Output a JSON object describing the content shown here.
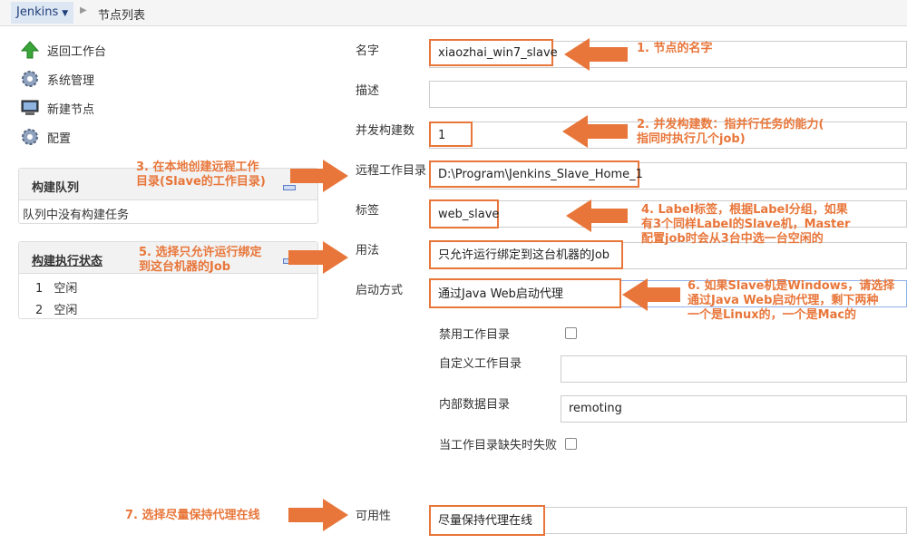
{
  "breadcrumb": {
    "root": "Jenkins",
    "current": "节点列表"
  },
  "sidebar": {
    "items": [
      {
        "label": "返回工作台",
        "icon": "up-arrow-icon"
      },
      {
        "label": "系统管理",
        "icon": "gear-icon"
      },
      {
        "label": "新建节点",
        "icon": "computer-icon"
      },
      {
        "label": "配置",
        "icon": "gear-icon"
      }
    ]
  },
  "build_queue": {
    "title": "构建队列",
    "empty_text": "队列中没有构建任务"
  },
  "executors": {
    "title": "构建执行状态",
    "rows": [
      {
        "num": "1",
        "status": "空闲"
      },
      {
        "num": "2",
        "status": "空闲"
      }
    ]
  },
  "form": {
    "name": {
      "label": "名字",
      "value": "xiaozhai_win7_slave"
    },
    "description": {
      "label": "描述",
      "value": ""
    },
    "executors": {
      "label": "并发构建数",
      "value": "1"
    },
    "remote_root": {
      "label": "远程工作目录",
      "value": "D:\\Program\\Jenkins_Slave_Home_1"
    },
    "labels": {
      "label": "标签",
      "value": "web_slave"
    },
    "usage": {
      "label": "用法",
      "value": "只允许运行绑定到这台机器的Job"
    },
    "launch": {
      "label": "启动方式",
      "value": "通过Java Web启动代理"
    },
    "disable_workdir": {
      "label": "禁用工作目录"
    },
    "custom_workdir": {
      "label": "自定义工作目录",
      "value": ""
    },
    "internal_dir": {
      "label": "内部数据目录",
      "value": "remoting"
    },
    "fail_missing": {
      "label": "当工作目录缺失时失败"
    },
    "availability": {
      "label": "可用性",
      "value": "尽量保持代理在线"
    }
  },
  "annotations": {
    "a1": "1. 节点的名字",
    "a2_line1": "2. 并发构建数：指并行任务的能力(",
    "a2_line2": "指同时执行几个job)",
    "a3_line1": "3. 在本地创建远程工作",
    "a3_line2": "目录(Slave的工作目录)",
    "a4_line1": "4. Label标签，根据Label分组，如果",
    "a4_line2": "有3个同样Label的Slave机，Master",
    "a4_line3": "配置job时会从3台中选一台空闲的",
    "a5_line1": "5. 选择只允许运行绑定",
    "a5_line2": "到这台机器的Job",
    "a6_line1": "6. 如果Slave机是Windows，请选择",
    "a6_line2": "通过Java Web启动代理，剩下两种",
    "a6_line3": "一个是Linux的，一个是Mac的",
    "a7": "7. 选择尽量保持代理在线"
  },
  "colors": {
    "annotation": "#e8763a",
    "accent": "#1f3f7a"
  }
}
